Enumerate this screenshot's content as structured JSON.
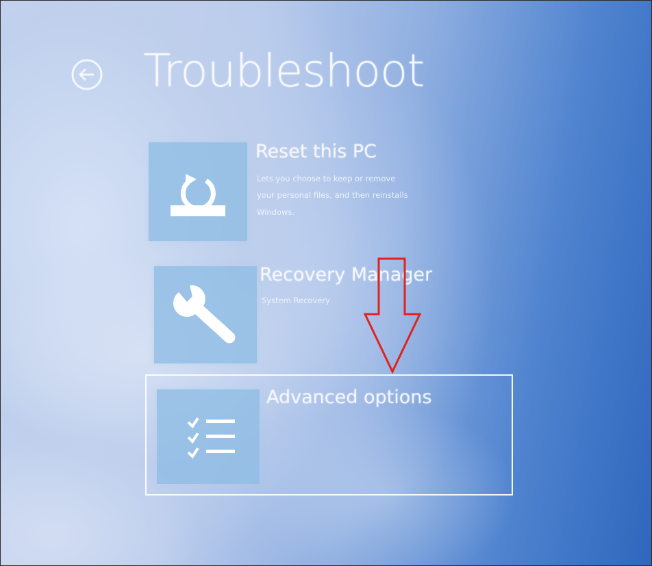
{
  "header": {
    "title": "Troubleshoot",
    "back_icon": "back-arrow-circle-icon"
  },
  "options": [
    {
      "title": "Reset this PC",
      "description_lines": [
        "Lets you choose to keep or remove",
        "your personal files, and then reinstalls",
        "Windows."
      ],
      "icon": "reset-pc-icon"
    },
    {
      "title": "Recovery Manager",
      "description_lines": [
        "System Recovery"
      ],
      "icon": "wrench-icon"
    },
    {
      "title": "Advanced options",
      "description_lines": [],
      "icon": "checklist-icon"
    }
  ],
  "annotation": {
    "arrow_color": "#e0231b",
    "highlight_color": "#ffffff"
  },
  "colors": {
    "tile": "#8ebce4",
    "background_light": "#c9d6ef",
    "background_dark": "#2f67bd"
  }
}
